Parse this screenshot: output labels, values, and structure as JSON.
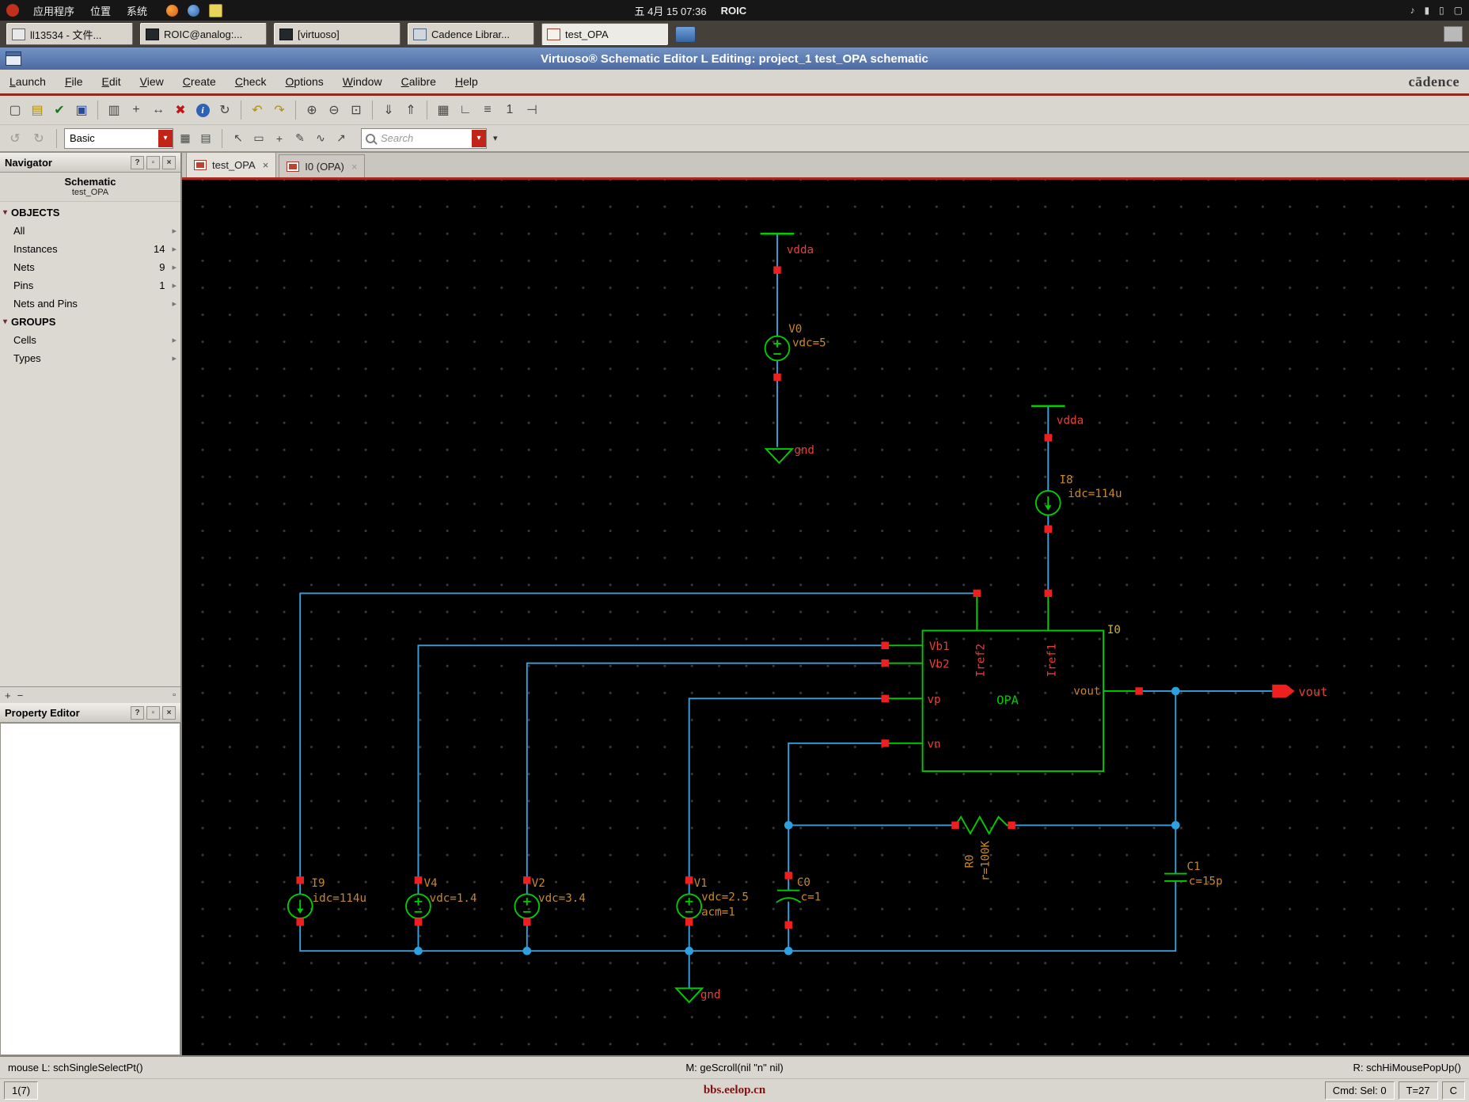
{
  "colors": {
    "wire": "#3aa0dc",
    "symbol": "#00cc00",
    "instance_label": "#c8882a",
    "pin_label": "#e54038",
    "titlebar": "#5b82b8",
    "accent_line": "#8e2a1e",
    "canvas_bg": "#000000",
    "junction": "#2da0e0",
    "terminal": "#ee1f1f"
  },
  "ui": {
    "dropdown": "▾",
    "arrow_right": "▸",
    "section_triangle": "▾",
    "close": "×",
    "help": "?",
    "float": "▫",
    "plus": "+",
    "minus": "−",
    "panel_box": "▫"
  },
  "desktop": {
    "menus": [
      "应用程序",
      "位置",
      "系统"
    ],
    "clock": "五 4月 15 07:36",
    "host": "ROIC",
    "tray_icons": [
      {
        "name": "volume",
        "glyph": "♪"
      },
      {
        "name": "battery",
        "glyph": "▮"
      },
      {
        "name": "input-device",
        "glyph": "▯"
      },
      {
        "name": "display",
        "glyph": "▢"
      }
    ]
  },
  "taskbar": {
    "buttons": [
      {
        "label": "ll13534 - 文件..."
      },
      {
        "label": "ROIC@analog:..."
      },
      {
        "label": "[virtuoso]"
      },
      {
        "label": "Cadence Librar..."
      },
      {
        "label": "test_OPA"
      }
    ]
  },
  "titlebar": {
    "title": "Virtuoso® Schematic Editor L Editing: project_1 test_OPA schematic"
  },
  "menubar": {
    "items": [
      "Launch",
      "File",
      "Edit",
      "View",
      "Create",
      "Check",
      "Options",
      "Window",
      "Calibre",
      "Help"
    ],
    "brand": "cādence"
  },
  "toolbar1": {
    "icons": [
      {
        "name": "new-cellview",
        "glyph": "▢"
      },
      {
        "name": "open",
        "glyph": "▤"
      },
      {
        "name": "check-and-save",
        "glyph": "✔"
      },
      {
        "name": "save",
        "glyph": "▣"
      },
      {
        "name": "copy",
        "glyph": "▥"
      },
      {
        "name": "move",
        "glyph": "+"
      },
      {
        "name": "stretch",
        "glyph": "↔"
      },
      {
        "name": "delete",
        "glyph": "✖"
      },
      {
        "name": "properties",
        "glyph": "i"
      },
      {
        "name": "rotate",
        "glyph": "↻"
      },
      {
        "name": "undo",
        "glyph": "↶"
      },
      {
        "name": "redo",
        "glyph": "↷"
      },
      {
        "name": "zoom-in",
        "glyph": "⊕"
      },
      {
        "name": "zoom-out",
        "glyph": "⊖"
      },
      {
        "name": "zoom-fit",
        "glyph": "⊡"
      },
      {
        "name": "descend-edit",
        "glyph": "⇓"
      },
      {
        "name": "return-to-top",
        "glyph": "⇑"
      },
      {
        "name": "create-instance",
        "glyph": "▦"
      },
      {
        "name": "create-wire",
        "glyph": "∟"
      },
      {
        "name": "create-bus",
        "glyph": "≡"
      },
      {
        "name": "create-wire-name",
        "glyph": "1"
      },
      {
        "name": "create-pin",
        "glyph": "⊣"
      }
    ]
  },
  "toolbar2": {
    "nav_icons": [
      {
        "name": "view-back",
        "glyph": "↺"
      },
      {
        "name": "view-forward",
        "glyph": "↻"
      }
    ],
    "workspace": {
      "value": "Basic"
    },
    "view_icons": [
      {
        "name": "hierarchy-table",
        "glyph": "▦"
      },
      {
        "name": "list-view",
        "glyph": "▤"
      }
    ],
    "mode_icons": [
      {
        "name": "single-select",
        "glyph": "↖"
      },
      {
        "name": "area-select",
        "glyph": "▭"
      },
      {
        "name": "move-mode",
        "glyph": "+"
      },
      {
        "name": "edit-mode",
        "glyph": "✎"
      },
      {
        "name": "wire-mode",
        "glyph": "∿"
      },
      {
        "name": "probe-mode",
        "glyph": "↗"
      }
    ],
    "search": {
      "placeholder": "Search"
    }
  },
  "navigator": {
    "title": "Navigator",
    "view_type": "Schematic",
    "cell_name": "test_OPA",
    "sections": [
      {
        "label": "OBJECTS",
        "items": [
          {
            "label": "All",
            "count": ""
          },
          {
            "label": "Instances",
            "count": "14"
          },
          {
            "label": "Nets",
            "count": "9"
          },
          {
            "label": "Pins",
            "count": "1"
          },
          {
            "label": "Nets and Pins",
            "count": ""
          }
        ]
      },
      {
        "label": "GROUPS",
        "items": [
          {
            "label": "Cells",
            "count": ""
          },
          {
            "label": "Types",
            "count": ""
          }
        ]
      }
    ]
  },
  "property_editor": {
    "title": "Property Editor"
  },
  "canvas": {
    "tabs": [
      {
        "label": "test_OPA",
        "close": "×"
      },
      {
        "label": "I0 (OPA)",
        "close": "×"
      }
    ]
  },
  "schematic": {
    "power_labels": {
      "vdda_v0": "vdda",
      "vdda_i8": "vdda",
      "gnd_v0": "gnd",
      "gnd_v1": "gnd"
    },
    "instances": {
      "v0": {
        "name": "V0",
        "value": "vdc=5"
      },
      "i8": {
        "name": "I8",
        "value": "idc=114u"
      },
      "i9": {
        "name": "I9",
        "value": "idc=114u"
      },
      "v4": {
        "name": "V4",
        "value": "vdc=1.4"
      },
      "v2": {
        "name": "V2",
        "value": "vdc=3.4"
      },
      "v1": {
        "name": "V1",
        "value": "vdc=2.5",
        "value2": "acm=1"
      },
      "c0": {
        "name": "C0",
        "value": "c=1"
      },
      "c1": {
        "name": "C1",
        "value": "c=15p"
      },
      "r0": {
        "name": "R0",
        "value": "r=100K"
      },
      "opa": {
        "name": "I0",
        "cell": "OPA",
        "pin_vb1": "Vb1",
        "pin_vb2": "Vb2",
        "pin_vp": "vp",
        "pin_vn": "vn",
        "pin_iref2": "Iref2",
        "pin_iref1": "Iref1",
        "pin_vout": "vout"
      }
    },
    "ports": {
      "vout": "vout"
    }
  },
  "statusbar": {
    "left": "mouse L: schSingleSelectPt()",
    "middle": "M: geScroll(nil \"n\" nil)",
    "right": "R: schHiMousePopUp()"
  },
  "bottombar": {
    "page": "1(7)",
    "watermark": "bbs.eelop.cn",
    "cmd": "Cmd: Sel: 0",
    "temp": "T=27",
    "unit": "C"
  }
}
